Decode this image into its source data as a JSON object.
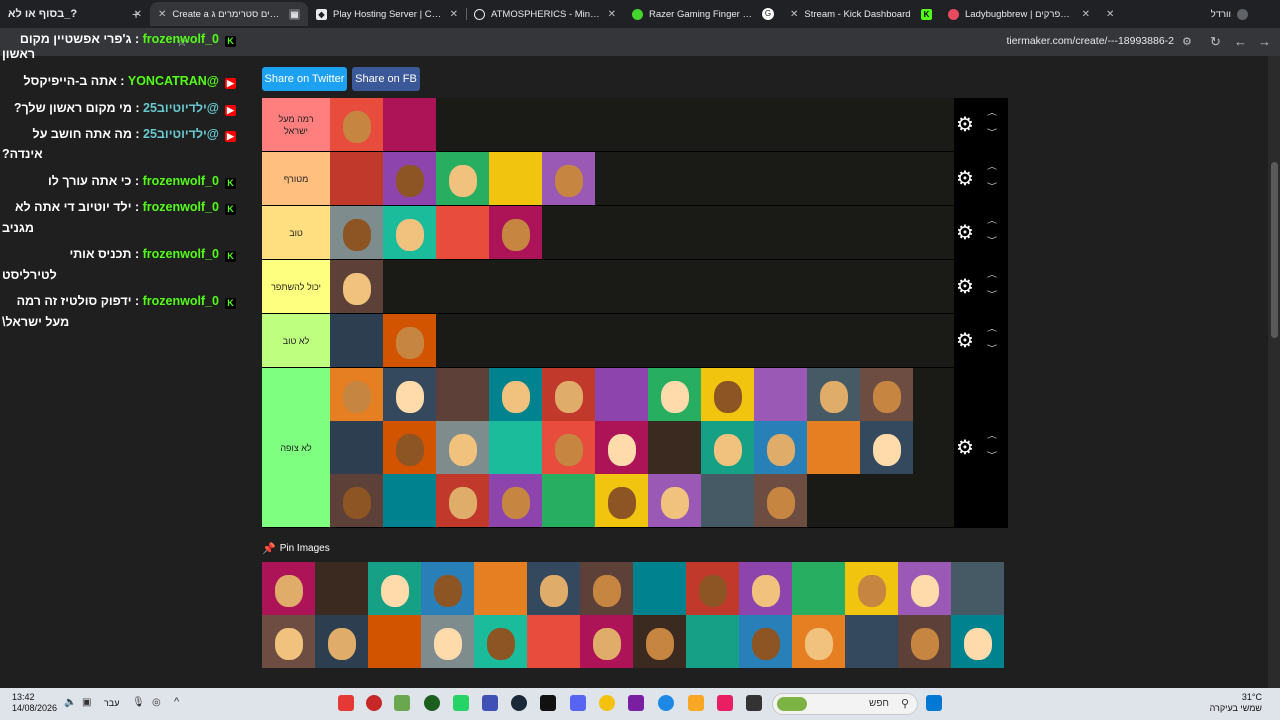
{
  "tabs": [
    {
      "title": "בסוף או לא_?",
      "active": false,
      "icon_color": "#2b2b2b"
    },
    {
      "title": "Create a יוטיוברים סטרימרים ג",
      "active": true,
      "icon_color": "#e8eaed"
    },
    {
      "title": "Play Hosting Server | Console",
      "active": false,
      "icon_color": "#e8eaed"
    },
    {
      "title": "ATMOSPHERICS - Minecraft M",
      "active": false,
      "icon_color": "#e8eaed"
    },
    {
      "title": "Razer Gaming Finger Sleeve - G",
      "active": false,
      "icon_color": "#44d62c"
    },
    {
      "title": "Stream - Kick Dashboard",
      "active": false,
      "icon_color": "#53fc18"
    },
    {
      "title": "Ladybugbbrew | כל הפרקים",
      "active": false,
      "icon_color": "#e84a5f"
    },
    {
      "title": "וורדל",
      "active": false,
      "icon_color": "#5f6368"
    }
  ],
  "address_bar": {
    "url": "tiermaker.com/create/---18993886-2"
  },
  "share": {
    "twitter": "Share on Twitter",
    "fb": "Share on FB"
  },
  "tiers": [
    {
      "label": "רמה מעל ישראל",
      "color": "#ff7f7f",
      "count": 2
    },
    {
      "label": "מטורף",
      "color": "#ffbf7f",
      "count": 5
    },
    {
      "label": "טוב",
      "color": "#ffdf7f",
      "count": 4
    },
    {
      "label": "יכול להשתפר",
      "color": "#ffff7f",
      "count": 1
    },
    {
      "label": "לא טוב",
      "color": "#bfff7f",
      "count": 2
    },
    {
      "label": "לא צופה",
      "color": "#7fff7f",
      "count": 31
    }
  ],
  "pin_images": {
    "label": "Pin Images"
  },
  "chat": [
    {
      "platform": "kick",
      "user": "frozenwolf_0",
      "message": "ג'פרי אפשטיין מקום",
      "wrap": "ראשון"
    },
    {
      "platform": "yt",
      "user": "@YONCATRAN",
      "message": "אתה ב-הייפיקסל",
      "wrap": ""
    },
    {
      "platform": "yt",
      "user": "@ילדיוטיוב25",
      "message": "מי מקום ראשון שלך?",
      "wrap": ""
    },
    {
      "platform": "yt",
      "user": "@ילדיוטיוב25",
      "message": "מה אתה חושב על",
      "wrap": "אינדה?"
    },
    {
      "platform": "kick",
      "user": "frozenwolf_0",
      "message": "כי אתה עורך לו",
      "wrap": ""
    },
    {
      "platform": "kick",
      "user": "frozenwolf_0",
      "message": "ילד יוטיוב די אתה לא",
      "wrap": "מגניב"
    },
    {
      "platform": "kick",
      "user": "frozenwolf_0",
      "message": "תכניס אותי",
      "wrap": "לטירליסט"
    },
    {
      "platform": "kick",
      "user": "frozenwolf_0",
      "message": "ידפוק סולטיז זה רמה",
      "wrap": "מעל ישראל\\"
    }
  ],
  "taskbar": {
    "search_placeholder": "חפש",
    "time": "13:42",
    "date": "14/08/2026",
    "lang": "עבר",
    "temp": "31°C",
    "weather": "שמשי בעיקרה"
  }
}
